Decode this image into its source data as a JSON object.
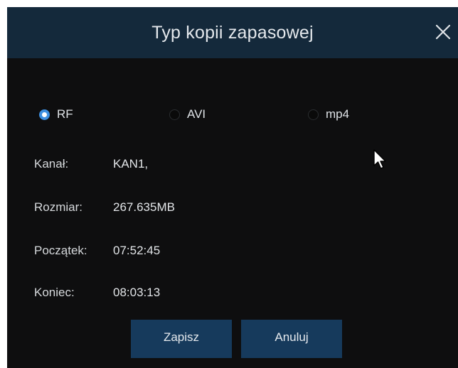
{
  "dialog": {
    "title": "Typ kopii zapasowej",
    "close_icon": "close-icon"
  },
  "format_options": [
    {
      "label": "RF",
      "selected": true
    },
    {
      "label": "AVI",
      "selected": false
    },
    {
      "label": "mp4",
      "selected": false
    }
  ],
  "fields": {
    "channel": {
      "label": "Kanał:",
      "value": "KAN1,"
    },
    "size": {
      "label": "Rozmiar:",
      "value": "267.635MB"
    },
    "start": {
      "label": "Początek:",
      "value": "07:52:45"
    },
    "end": {
      "label": "Koniec:",
      "value": "08:03:13"
    }
  },
  "buttons": {
    "save": "Zapisz",
    "cancel": "Anuluj"
  },
  "colors": {
    "titlebar": "#14293b",
    "background": "#0e0e0f",
    "accent": "#3d8fe0",
    "button": "#163a5c"
  }
}
